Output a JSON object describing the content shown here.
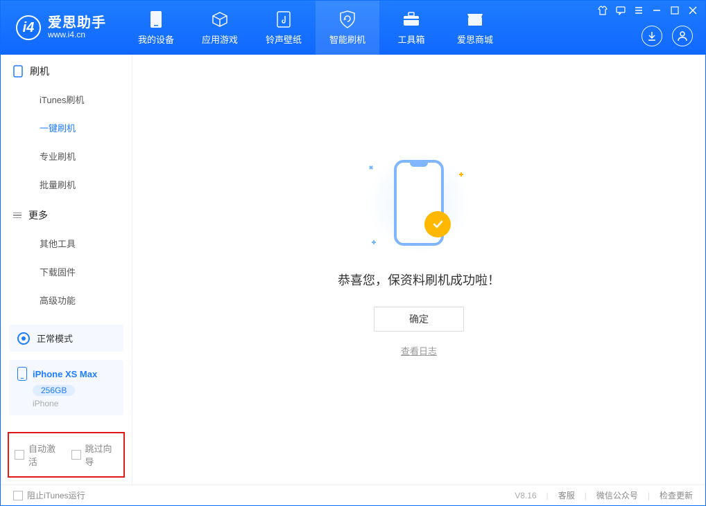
{
  "app": {
    "title": "爱思助手",
    "subtitle": "www.i4.cn"
  },
  "nav": {
    "tabs": [
      {
        "label": "我的设备"
      },
      {
        "label": "应用游戏"
      },
      {
        "label": "铃声壁纸"
      },
      {
        "label": "智能刷机"
      },
      {
        "label": "工具箱"
      },
      {
        "label": "爱思商城"
      }
    ]
  },
  "sidebar": {
    "section1": {
      "title": "刷机",
      "items": [
        "iTunes刷机",
        "一键刷机",
        "专业刷机",
        "批量刷机"
      ]
    },
    "section2": {
      "title": "更多",
      "items": [
        "其他工具",
        "下载固件",
        "高级功能"
      ]
    },
    "mode": {
      "label": "正常模式"
    },
    "device": {
      "name": "iPhone XS Max",
      "storage": "256GB",
      "sub": "iPhone"
    },
    "options": {
      "opt1": "自动激活",
      "opt2": "跳过向导"
    }
  },
  "main": {
    "success_text": "恭喜您，保资料刷机成功啦！",
    "confirm": "确定",
    "view_log": "查看日志"
  },
  "footer": {
    "block_itunes": "阻止iTunes运行",
    "version": "V8.16",
    "links": [
      "客服",
      "微信公众号",
      "检查更新"
    ]
  }
}
